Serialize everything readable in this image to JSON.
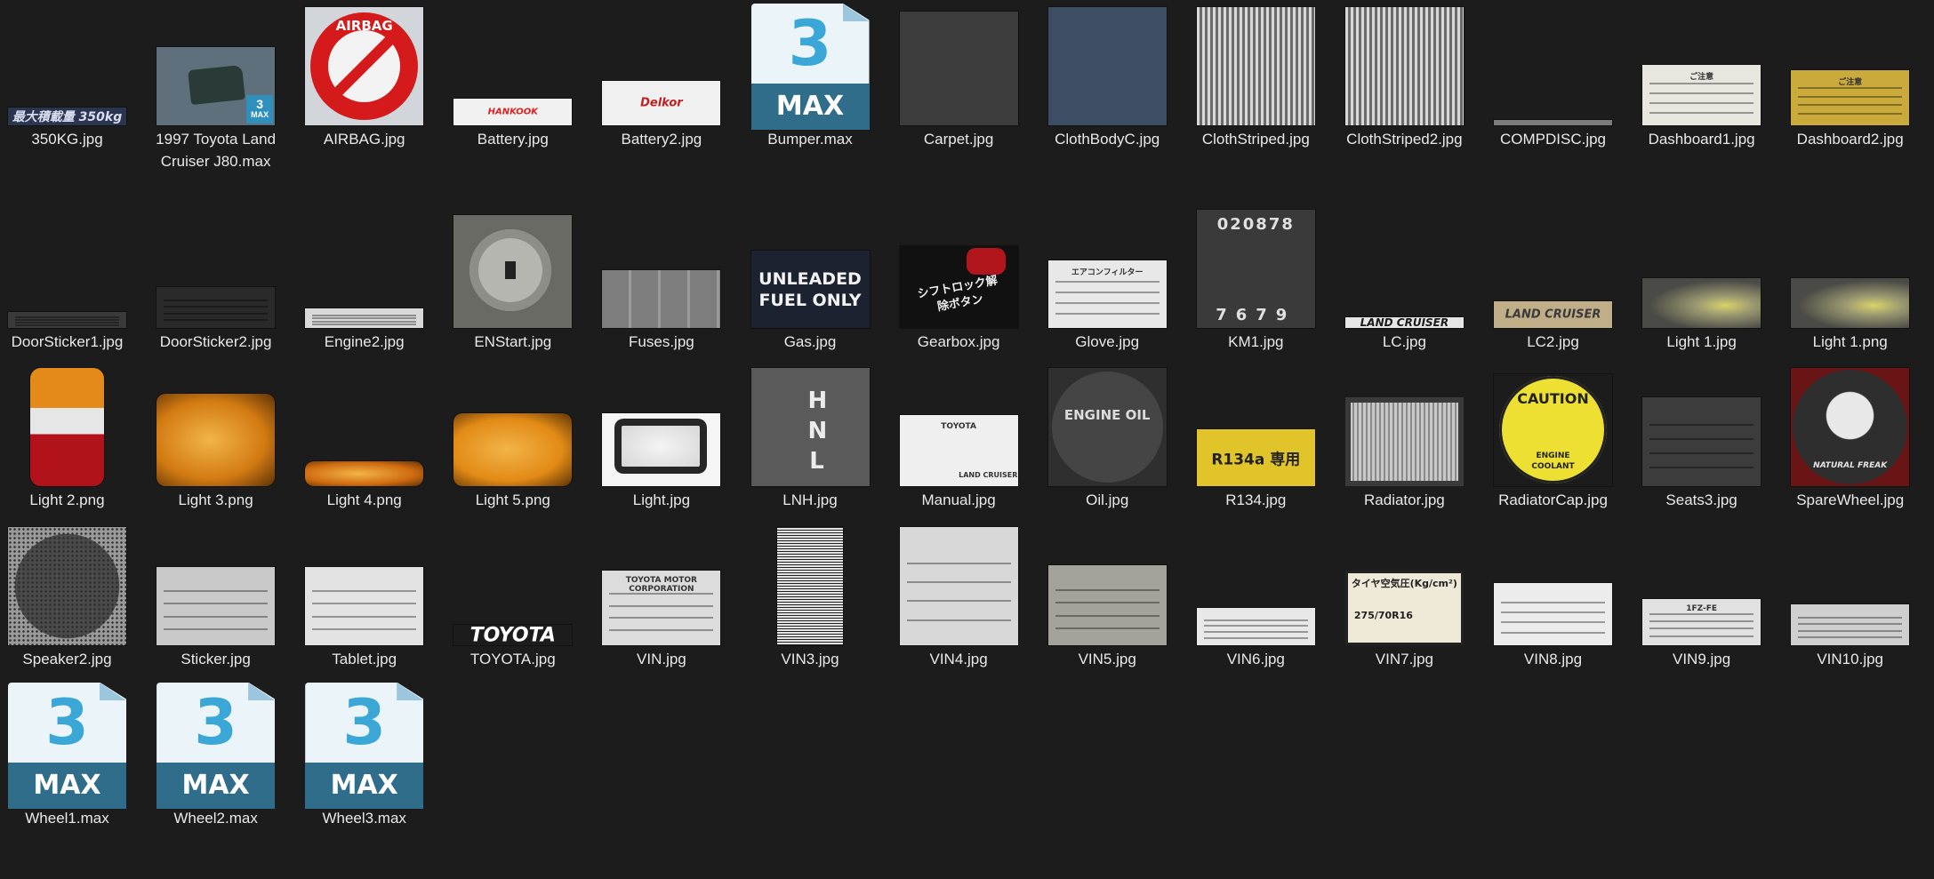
{
  "files": [
    {
      "name": "350KG.jpg",
      "kind": "label",
      "bg": "#2c3550",
      "fg": "#d8def0",
      "text": "最大積載量 350kg",
      "h": 20,
      "fs": 14
    },
    {
      "name": "1997 Toyota Land Cruiser J80.max",
      "kind": "render",
      "bg": "#5f6f7c",
      "h": 88,
      "badge": "MAX"
    },
    {
      "name": "AIRBAG.jpg",
      "kind": "airbag",
      "bg": "#d2d6db",
      "text": "AIRBAG",
      "h": 133
    },
    {
      "name": "Battery.jpg",
      "kind": "label",
      "bg": "#f1f1f1",
      "fg": "#d22",
      "text": "HANKOOK",
      "h": 30,
      "fs": 10
    },
    {
      "name": "Battery2.jpg",
      "kind": "label",
      "bg": "#f0f0f0",
      "fg": "#c02020",
      "text": "Delkor",
      "h": 50,
      "fs": 13
    },
    {
      "name": "Bumper.max",
      "kind": "max",
      "three": "3",
      "word": "MAX"
    },
    {
      "name": "Carpet.jpg",
      "kind": "solid",
      "bg": "#3c3c3c",
      "h": 128
    },
    {
      "name": "ClothBodyC.jpg",
      "kind": "solid",
      "bg": "#3d4d63",
      "h": 133
    },
    {
      "name": "ClothStriped.jpg",
      "kind": "stripes",
      "bg": "#9a9a9a",
      "h": 133
    },
    {
      "name": "ClothStriped2.jpg",
      "kind": "stripes",
      "bg": "#8f8f8f",
      "h": 133
    },
    {
      "name": "COMPDISC.jpg",
      "kind": "solid",
      "bg": "#7c7c7c",
      "h": 6
    },
    {
      "name": "Dashboard1.jpg",
      "kind": "sticker",
      "bg": "#e7e6df",
      "fg": "#333",
      "text": "ご注意",
      "h": 68
    },
    {
      "name": "Dashboard2.jpg",
      "kind": "sticker",
      "bg": "#c9aa3a",
      "fg": "#333",
      "text": "ご注意",
      "h": 62
    },
    {
      "name": "DoorSticker1.jpg",
      "kind": "sticker",
      "bg": "#3a3a3a",
      "fg": "#bbb",
      "text": "",
      "h": 18
    },
    {
      "name": "DoorSticker2.jpg",
      "kind": "sticker",
      "bg": "#2a2a2a",
      "fg": "#ddd",
      "text": "",
      "h": 46
    },
    {
      "name": "Engine2.jpg",
      "kind": "sticker",
      "bg": "#d9d9d9",
      "fg": "#333",
      "text": "",
      "h": 22
    },
    {
      "name": "ENStart.jpg",
      "kind": "ignition",
      "bg": "#6a6a64",
      "h": 127
    },
    {
      "name": "Fuses.jpg",
      "kind": "fuses",
      "bg": "#8a8a8a",
      "h": 65
    },
    {
      "name": "Gas.jpg",
      "kind": "gas",
      "bg": "#1d2230",
      "fg": "#f3f3f3",
      "text": "UNLEADED FUEL ONLY",
      "h": 87
    },
    {
      "name": "Gearbox.jpg",
      "kind": "gearbox",
      "bg": "#111",
      "fg": "#eee",
      "text": "シフトロック解除ボタン",
      "h": 92
    },
    {
      "name": "Glove.jpg",
      "kind": "sticker",
      "bg": "#e8e8e8",
      "fg": "#333",
      "text": "エアコンフィルター",
      "h": 76
    },
    {
      "name": "KM1.jpg",
      "kind": "km",
      "bg": "#3a3a3a",
      "fg": "#e0e0e0",
      "text": "020878",
      "text2": "7679",
      "h": 133
    },
    {
      "name": "LC.jpg",
      "kind": "label",
      "bg": "#e6e6e6",
      "fg": "#1a1a1a",
      "text": "LAND CRUISER",
      "h": 12,
      "fs": 12
    },
    {
      "name": "LC2.jpg",
      "kind": "label",
      "bg": "#bfae88",
      "fg": "#3a3a3a",
      "text": "LAND CRUISER",
      "h": 30,
      "fs": 13
    },
    {
      "name": "Light 1.jpg",
      "kind": "headlight",
      "bg": "#4a4a46",
      "h": 56
    },
    {
      "name": "Light 1.png",
      "kind": "headlight",
      "bg": "#4a4a46",
      "h": 56
    },
    {
      "name": "Light 2.png",
      "kind": "taillight",
      "bg": "#b2121a",
      "h": 133
    },
    {
      "name": "Light 3.png",
      "kind": "amber",
      "bg": "#d27a12",
      "h": 104
    },
    {
      "name": "Light 4.png",
      "kind": "amber",
      "bg": "#d06b10",
      "h": 28
    },
    {
      "name": "Light 5.png",
      "kind": "amber",
      "bg": "#e28a15",
      "h": 82
    },
    {
      "name": "Light.jpg",
      "kind": "foglight",
      "bg": "#f5f5f5",
      "h": 82
    },
    {
      "name": "LNH.jpg",
      "kind": "lnh",
      "bg": "#5a5a5a",
      "fg": "#ececec",
      "text": "H N L",
      "h": 133
    },
    {
      "name": "Manual.jpg",
      "kind": "manual",
      "bg": "#efefef",
      "fg": "#333",
      "text": "TOYOTA",
      "text2": "LAND CRUISER",
      "h": 80
    },
    {
      "name": "Oil.jpg",
      "kind": "oil",
      "bg": "#2f2f2f",
      "fg": "#dcdcdc",
      "text": "ENGINE OIL",
      "h": 133
    },
    {
      "name": "R134.jpg",
      "kind": "r134",
      "bg": "#e0c42a",
      "fg": "#222",
      "text": "R134a 専用",
      "h": 64
    },
    {
      "name": "Radiator.jpg",
      "kind": "radiator",
      "bg": "#b8b8b8",
      "h": 100
    },
    {
      "name": "RadiatorCap.jpg",
      "kind": "radcap",
      "bg": "#e4d31c",
      "fg": "#222",
      "text": "CAUTION",
      "text2": "ENGINE COOLANT",
      "h": 126
    },
    {
      "name": "Seats3.jpg",
      "kind": "sticker",
      "bg": "#3c3c3c",
      "fg": "#ddd",
      "text": "",
      "h": 100
    },
    {
      "name": "SpareWheel.jpg",
      "kind": "spare",
      "bg": "#3a3a3a",
      "fg": "#e6e6e6",
      "text": "NATURAL FREAK",
      "h": 133
    },
    {
      "name": "Speaker2.jpg",
      "kind": "speaker",
      "bg": "#6a6a6a",
      "h": 133
    },
    {
      "name": "Sticker.jpg",
      "kind": "sticker",
      "bg": "#c9c9c9",
      "fg": "#222",
      "text": "",
      "h": 88
    },
    {
      "name": "Tablet.jpg",
      "kind": "sticker",
      "bg": "#e3e3e3",
      "fg": "#333",
      "text": "",
      "h": 88
    },
    {
      "name": "TOYOTA.jpg",
      "kind": "label",
      "bg": "#d9d9d9",
      "fg": "#ffffff",
      "text": "TOYOTA",
      "h": 23,
      "fs": 22,
      "dark": "#1c1c1c"
    },
    {
      "name": "VIN.jpg",
      "kind": "sticker",
      "bg": "#dcdcdc",
      "fg": "#333",
      "text": "TOYOTA MOTOR CORPORATION",
      "h": 84
    },
    {
      "name": "VIN3.jpg",
      "kind": "barcode",
      "bg": "#e3e3e3",
      "h": 133
    },
    {
      "name": "VIN4.jpg",
      "kind": "sticker",
      "bg": "#d8d8d8",
      "fg": "#333",
      "text": "",
      "h": 133
    },
    {
      "name": "VIN5.jpg",
      "kind": "sticker",
      "bg": "#a3a39c",
      "fg": "#333",
      "text": "",
      "h": 90
    },
    {
      "name": "VIN6.jpg",
      "kind": "sticker",
      "bg": "#e8e8e8",
      "fg": "#333",
      "text": "",
      "h": 42
    },
    {
      "name": "VIN7.jpg",
      "kind": "vin7",
      "bg": "#efe9d8",
      "fg": "#222",
      "text": "タイヤ空気圧(Kg/cm²)",
      "text2": "275/70R16",
      "h": 84
    },
    {
      "name": "VIN8.jpg",
      "kind": "sticker",
      "bg": "#ececec",
      "fg": "#333",
      "text": "",
      "h": 70
    },
    {
      "name": "VIN9.jpg",
      "kind": "sticker",
      "bg": "#e1e1e1",
      "fg": "#333",
      "text": "1FZ-FE",
      "h": 52
    },
    {
      "name": "VIN10.jpg",
      "kind": "sticker",
      "bg": "#cfcfcf",
      "fg": "#333",
      "text": "",
      "h": 46
    },
    {
      "name": "Wheel1.max",
      "kind": "max",
      "three": "3",
      "word": "MAX"
    },
    {
      "name": "Wheel2.max",
      "kind": "max",
      "three": "3",
      "word": "MAX"
    },
    {
      "name": "Wheel3.max",
      "kind": "max",
      "three": "3",
      "word": "MAX"
    }
  ]
}
